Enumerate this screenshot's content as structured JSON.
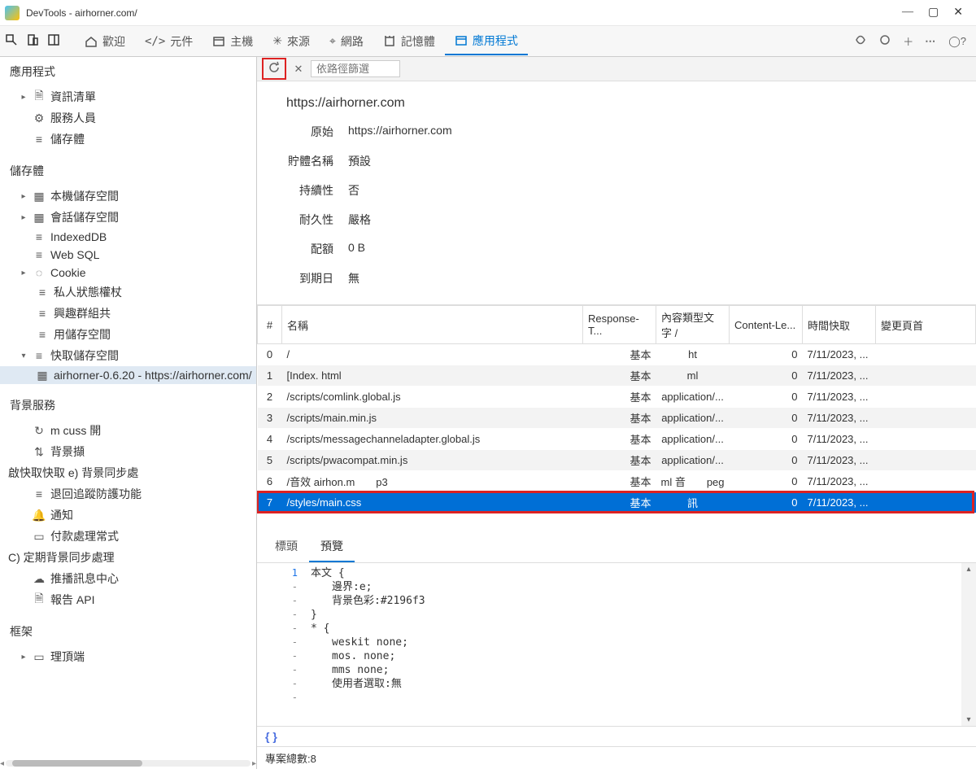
{
  "window": {
    "title": "DevTools - airhorner.com/"
  },
  "tabs": {
    "welcome": "歡迎",
    "elements": "元件",
    "host": "主機",
    "sources": "來源",
    "network": "網路",
    "memory": "記憶體",
    "application": "應用程式"
  },
  "sidebar": {
    "app_section": "應用程式",
    "manifest": "資訊清單",
    "service_workers": "服務人員",
    "storage_label": "儲存體",
    "storage_section": "儲存體",
    "local_storage": "本機儲存空間",
    "session_storage": "會話儲存空間",
    "indexeddb": "IndexedDB",
    "websql": "Web SQL",
    "cookie": "Cookie",
    "private_state": "私人狀態權杖",
    "interest_groups": "興趣群組共",
    "shared_storage": "用儲存空間",
    "cache_storage": "快取儲存空間",
    "cache_entry": "airhorner-0.6.20 - https://airhorner.com/",
    "bg_services": "背景服務",
    "bg_items": [
      "m cuss 開",
      "背景擷",
      "啟快取快取 e) 背景同步處",
      "退回追蹤防護功能",
      "通知",
      "付款處理常式",
      "C) 定期背景同步處理",
      "推播訊息中心",
      "報告 API"
    ],
    "frames": "框架",
    "top_frame": "理頂端"
  },
  "toolbar": {
    "filter_placeholder": "依路徑篩選"
  },
  "cache_detail": {
    "url": "https://airhorner.com",
    "rows": [
      {
        "label": "原始",
        "value": "https://airhorner.com"
      },
      {
        "label": "貯體名稱",
        "value": "預設"
      },
      {
        "label": "持續性",
        "value": "否"
      },
      {
        "label": "耐久性",
        "value": "嚴格"
      },
      {
        "label": "配額",
        "value": "0 B"
      },
      {
        "label": "到期日",
        "value": "無"
      }
    ]
  },
  "columns": {
    "num": "#",
    "name": "名稱",
    "response_type": "Response-T...",
    "content_type": "內容類型文字 /",
    "content_length": "Content-Le...",
    "time_cached": "時間快取",
    "vary": "變更頁首"
  },
  "rows": [
    {
      "n": "0",
      "name": "/",
      "rt": "基本",
      "ct": "ht",
      "cl": "0",
      "tc": "7/11/2023, ...",
      "v": ""
    },
    {
      "n": "1",
      "name": "[Index. html",
      "rt": "基本",
      "ct": "ml",
      "cl": "0",
      "tc": "7/11/2023, ...",
      "v": ""
    },
    {
      "n": "2",
      "name": "/scripts/comlink.global.js",
      "rt": "基本",
      "ct": "application/...",
      "cl": "0",
      "tc": "7/11/2023, ...",
      "v": ""
    },
    {
      "n": "3",
      "name": "/scripts/main.min.js",
      "rt": "基本",
      "ct": "application/...",
      "cl": "0",
      "tc": "7/11/2023, ...",
      "v": ""
    },
    {
      "n": "4",
      "name": "/scripts/messagechanneladapter.global.js",
      "rt": "基本",
      "ct": "application/...",
      "cl": "0",
      "tc": "7/11/2023, ...",
      "v": ""
    },
    {
      "n": "5",
      "name": "/scripts/pwacompat.min.js",
      "rt": "基本",
      "ct": "application/...",
      "cl": "0",
      "tc": "7/11/2023, ...",
      "v": ""
    },
    {
      "n": "6",
      "name": "/音效 airhon.m　　p3",
      "rt": "基本",
      "ct": "ml 音　　peg",
      "cl": "0",
      "tc": "7/11/2023, ...",
      "v": ""
    },
    {
      "n": "7",
      "name": "/styles/main.css",
      "rt": "基本",
      "ct": "訊",
      "cl": "0",
      "tc": "7/11/2023, ...",
      "v": ""
    }
  ],
  "subtabs": {
    "headers": "標頭",
    "preview": "預覽"
  },
  "preview": {
    "gutter": [
      "1",
      "-",
      "-",
      "-",
      "-",
      "-",
      "-",
      "-",
      "-",
      "-"
    ],
    "lines": [
      "本文 {",
      "　　邊界:e;",
      "　　背景色彩:#2196f3",
      "}",
      "",
      "* {",
      "　　weskit none;",
      "　　mos. none;",
      "　　mms none;",
      "　　使用者選取:無"
    ]
  },
  "footer": {
    "braces": "{ }",
    "total": "專案總數:8"
  }
}
